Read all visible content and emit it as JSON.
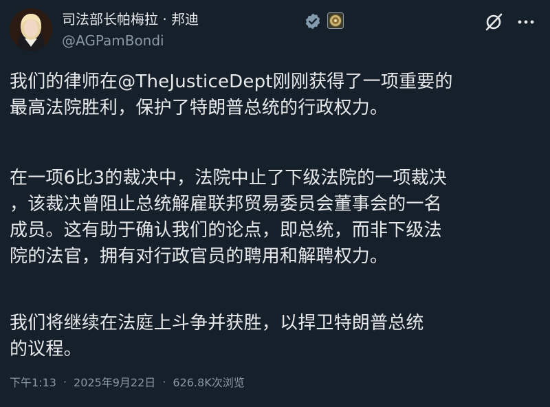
{
  "author": {
    "display_name": "司法部长帕梅拉 · 邦迪",
    "handle": "@AGPamBondi"
  },
  "badges": {
    "verified": "verified-icon",
    "affiliation": "doj-seal-icon",
    "verified_color": "#829aab"
  },
  "actions": {
    "grok": "grok-icon",
    "more": "more-icon"
  },
  "post": {
    "paragraphs": [
      "我们的律师在@TheJusticeDept刚刚获得了一项重要的\n最高法院胜利，保护了特朗普总统的行政权力。",
      "在一项6比3的裁决中，法院中止了下级法院的一项裁决\n，该裁决曾阻止总统解雇联邦贸易委员会董事会的一名\n成员。这有助于确认我们的论点，即总统，而非下级法\n院的法官，拥有对行政官员的聘用和解聘权力。",
      "我们将继续在法庭上斗争并获胜，以捍卫特朗普总统\n的议程。"
    ]
  },
  "meta": {
    "time": "下午1:13",
    "date": "2025年9月22日",
    "views": "626.8K次浏览",
    "separator": "·"
  },
  "colors": {
    "background": "#15202b",
    "text": "#e7e9ea",
    "secondary": "#8b98a5"
  }
}
